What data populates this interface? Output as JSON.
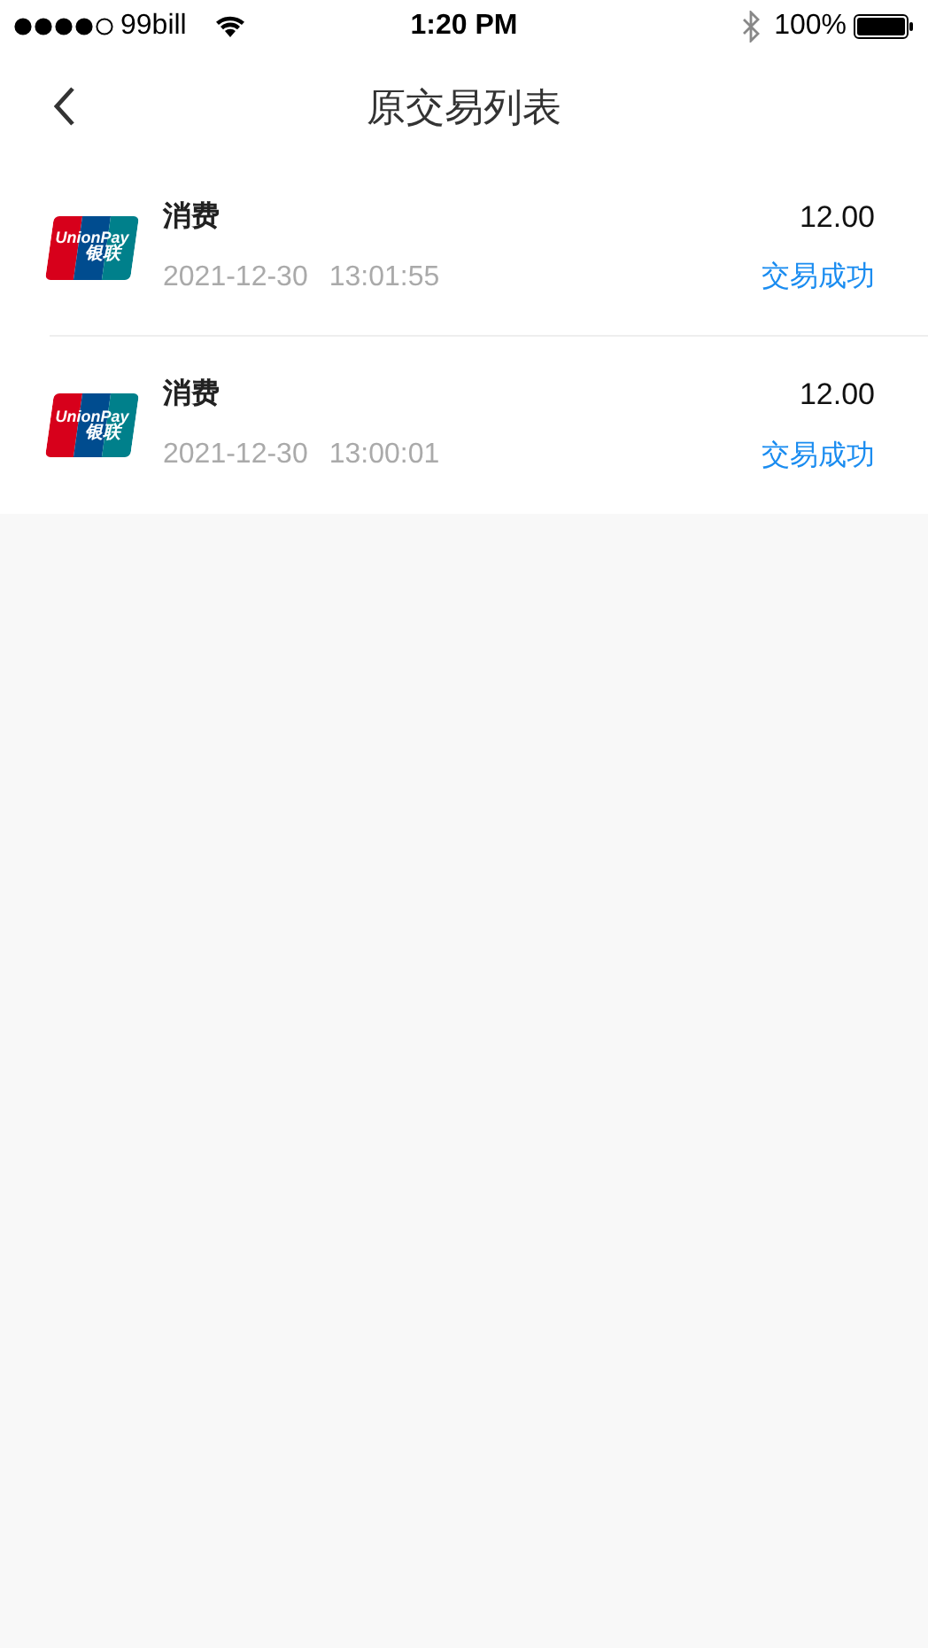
{
  "status_bar": {
    "carrier": "99bill",
    "time": "1:20 PM",
    "battery": "100%"
  },
  "header": {
    "title": "原交易列表"
  },
  "transactions": [
    {
      "logo_text": "UnionPay",
      "logo_subtext": "银联",
      "type": "消费",
      "date": "2021-12-30",
      "time": "13:01:55",
      "amount": "12.00",
      "status": "交易成功"
    },
    {
      "logo_text": "UnionPay",
      "logo_subtext": "银联",
      "type": "消费",
      "date": "2021-12-30",
      "time": "13:00:01",
      "amount": "12.00",
      "status": "交易成功"
    }
  ]
}
